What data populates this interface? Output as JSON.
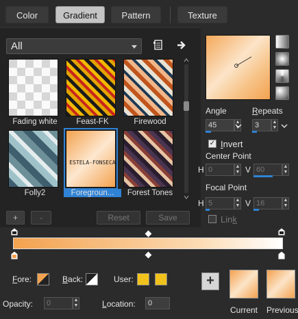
{
  "tabs": [
    "Color",
    "Gradient",
    "Pattern",
    "Texture"
  ],
  "active_tab": "Gradient",
  "category": "All",
  "swatches": [
    {
      "label": "Fading white"
    },
    {
      "label": "Feast-FK"
    },
    {
      "label": "Firewood"
    },
    {
      "label": "Folly2"
    },
    {
      "label": "Foregroun...",
      "selected": true,
      "watermark": "ESTELA-FONSECA"
    },
    {
      "label": "Forest Tones"
    }
  ],
  "buttons": {
    "add": "+",
    "remove": "-",
    "reset": "Reset",
    "save": "Save"
  },
  "angle": {
    "label": "Angle",
    "value": "45"
  },
  "repeats": {
    "label": "Repeats",
    "value": "3"
  },
  "invert": {
    "label": "Invert",
    "checked": true
  },
  "center_point": {
    "label": "Center Point",
    "h_label": "H",
    "h": "0",
    "v_label": "V",
    "v": "60"
  },
  "focal_point": {
    "label": "Focal Point",
    "h_label": "H",
    "h": "5",
    "v_label": "V",
    "v": "16"
  },
  "link": {
    "label": "Link",
    "checked": false
  },
  "fore": {
    "label": "Fore:"
  },
  "back": {
    "label": "Back:"
  },
  "user": {
    "label": "User:",
    "color": "#f2c21c"
  },
  "opacity": {
    "label": "Opacity:",
    "value": "0"
  },
  "location": {
    "label": "Location:",
    "value": "0"
  },
  "current_label": "Current",
  "previous_label": "Previous",
  "colors": {
    "accent": "#2f83d6",
    "gradient_start": "#f3a24f",
    "gradient_end": "#ffffff"
  }
}
